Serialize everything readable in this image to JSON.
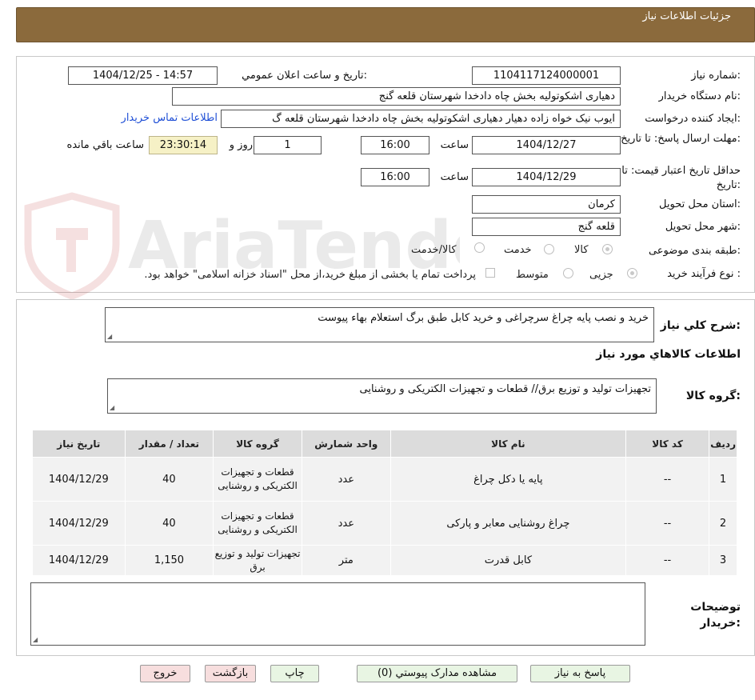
{
  "header": {
    "title": "جزئیات اطلاعات نیاز"
  },
  "watermark": {
    "text": "AriaTender.neT"
  },
  "form": {
    "need_number_label": "شماره نیاز:",
    "need_number": "1104117124000001",
    "announce_label": "تاریخ و ساعت اعلان عمومي:",
    "announce_value": "1404/12/25 - 14:57",
    "buyer_org_label": "نام دستگاه خریدار:",
    "buyer_org": "دهیاری اشکوتولیه بخش چاه دادخدا شهرستان قلعه گنج",
    "creator_label": "ایجاد کننده درخواست:",
    "creator": "ایوب نیک خواه زاده دهیار دهیاری اشکوتولیه بخش چاه دادخدا شهرستان قلعه گ",
    "contact_link": "اطلاعات تماس خریدار",
    "deadline_label": "مهلت ارسال پاسخ: تا تاریخ:",
    "deadline_date": "1404/12/27",
    "time_label": "ساعت",
    "deadline_time": "16:00",
    "days_value": "1",
    "days_label": "روز و",
    "remaining_time": "23:30:14",
    "remaining_label": "ساعت باقي مانده",
    "validity_label": "حداقل تاریخ اعتبار قیمت: تا تاریخ:",
    "validity_date": "1404/12/29",
    "validity_time": "16:00",
    "province_label": "استان محل تحویل:",
    "province": "کرمان",
    "city_label": "شهر محل تحویل:",
    "city": "قلعه گنج",
    "category_label": "طبقه بندی موضوعی:",
    "category_options": [
      "کالا",
      "خدمت",
      "کالا/خدمت"
    ],
    "process_label": "نوع فرآیند خرید :",
    "process_options": [
      "جزیی",
      "متوسط"
    ],
    "payment_note": "پرداخت تمام یا بخشی از مبلغ خرید،از محل \"اسناد خزانه اسلامی\" خواهد بود."
  },
  "description": {
    "label": "شرح کلي نیاز:",
    "text": "خرید و نصب پایه چراغ سرچراغی  و خرید کابل  طبق برگ استعلام بهاء پیوست"
  },
  "items_section": {
    "title": "اطلاعات کالاهاي مورد نیاز",
    "group_label": "گروه کالا:",
    "group_text": "تجهیزات تولید و توزیع برق// قطعات و تجهیزات الکتریکی و روشنایی"
  },
  "table": {
    "headers": [
      "ردیف",
      "کد کالا",
      "نام کالا",
      "واحد شمارش",
      "گروه کالا",
      "تعداد / مقدار",
      "تاریخ نیاز"
    ],
    "rows": [
      {
        "row": "1",
        "code": "--",
        "name": "پایه یا دکل چراغ",
        "unit": "عدد",
        "group": "قطعات و تجهیزات الکتریکی و روشنایی",
        "qty": "40",
        "date": "1404/12/29"
      },
      {
        "row": "2",
        "code": "--",
        "name": "چراغ روشنایی معابر و پارکی",
        "unit": "عدد",
        "group": "قطعات و تجهیزات الکتریکی و روشنایی",
        "qty": "40",
        "date": "1404/12/29"
      },
      {
        "row": "3",
        "code": "--",
        "name": "کابل قدرت",
        "unit": "متر",
        "group": "تجهیزات تولید و توزیع برق",
        "qty": "1,150",
        "date": "1404/12/29"
      }
    ]
  },
  "buyer_notes": {
    "label": "توضیحات خریدار:",
    "text": ""
  },
  "buttons": {
    "reply": "پاسخ به نیاز",
    "attachments": "مشاهده مدارک پیوستي (0)",
    "print": "چاپ",
    "back": "بازگشت",
    "exit": "خروج"
  }
}
